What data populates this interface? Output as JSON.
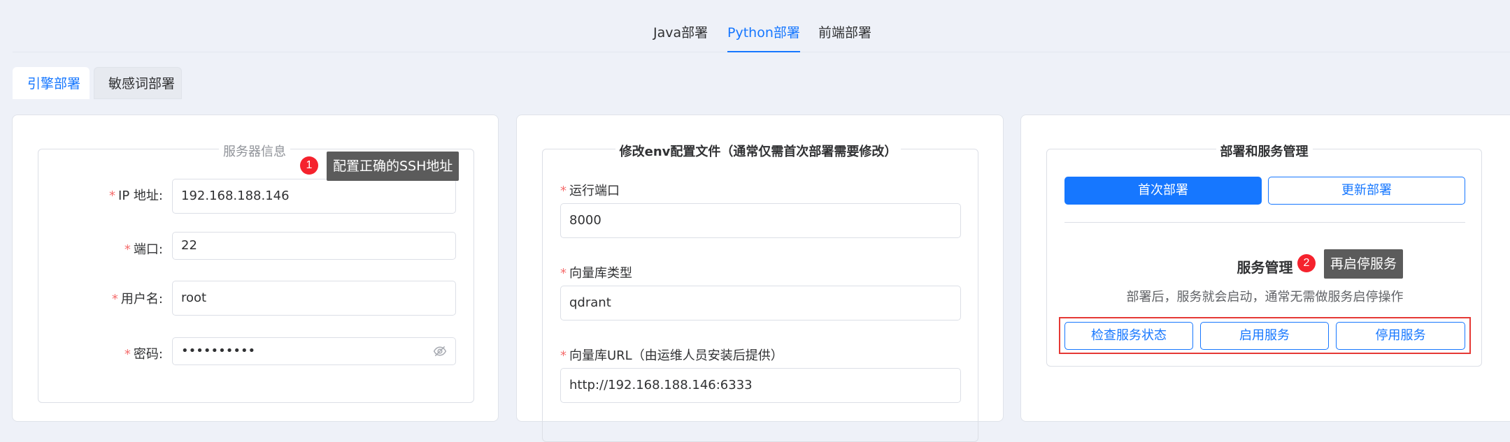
{
  "top_tabs": [
    {
      "label": "Java部署"
    },
    {
      "label": "Python部署"
    },
    {
      "label": "前端部署"
    }
  ],
  "sub_tabs": [
    {
      "label": "引擎部署"
    },
    {
      "label": "敏感词部署"
    }
  ],
  "server_panel": {
    "legend": "服务器信息",
    "fields": {
      "ip": {
        "label": "IP 地址:",
        "value": "192.168.188.146"
      },
      "port": {
        "label": "端口:",
        "value": "22"
      },
      "username": {
        "label": "用户名:",
        "value": "root"
      },
      "password": {
        "label": "密码:",
        "value": "••••••••••"
      }
    },
    "tip": {
      "number": "1",
      "text": "配置正确的SSH地址"
    }
  },
  "env_panel": {
    "legend": "修改env配置文件（通常仅需首次部署需要修改）",
    "fields": {
      "run_port": {
        "label": "运行端口",
        "value": "8000"
      },
      "vector_type": {
        "label": "向量库类型",
        "value": "qdrant"
      },
      "vector_url": {
        "label": "向量库URL（由运维人员安装后提供）",
        "value": "http://192.168.188.146:6333"
      }
    }
  },
  "deploy_panel": {
    "legend": "部署和服务管理",
    "first_deploy_label": "首次部署",
    "update_deploy_label": "更新部署",
    "service_title": "服务管理",
    "service_desc": "部署后，服务就会启动，通常无需做服务启停操作",
    "tip": {
      "number": "2",
      "text": "再启停服务"
    },
    "check_status_label": "检查服务状态",
    "start_service_label": "启用服务",
    "stop_service_label": "停用服务"
  },
  "colors": {
    "primary": "#1677ff",
    "highlight_border": "#e53935",
    "tip_badge": "#f5222d",
    "required_mark": "#f56c6c"
  }
}
